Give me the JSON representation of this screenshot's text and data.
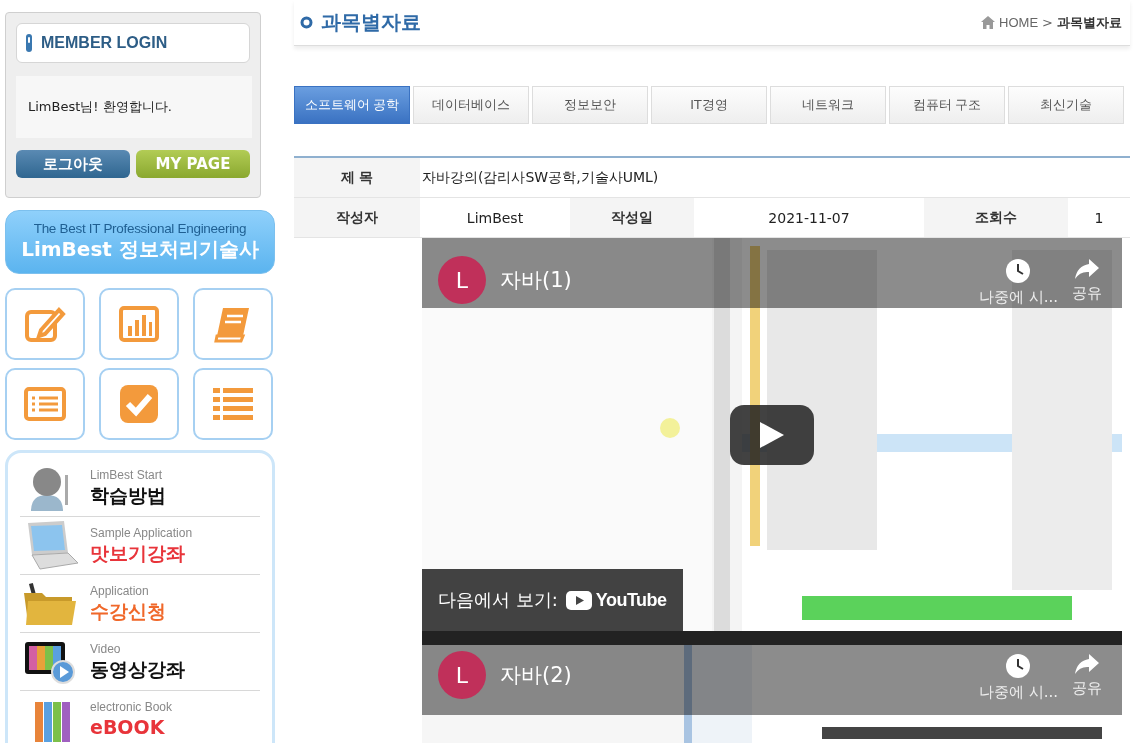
{
  "sidebar": {
    "login": {
      "title": "MEMBER LOGIN",
      "welcome": "LimBest님! 환영합니다.",
      "buttons": [
        {
          "label": "로그아웃",
          "kind": "logout"
        },
        {
          "label": "MY PAGE",
          "kind": "mypage"
        }
      ]
    },
    "banner": {
      "subtitle": "The Best IT Professional Engineering",
      "title": "LimBest 정보처리기술사"
    },
    "menu": [
      {
        "caption": "LimBest Start",
        "label": "학습방법",
        "color": "#111111"
      },
      {
        "caption": "Sample Application",
        "label": "맛보기강좌",
        "color": "#e8343a"
      },
      {
        "caption": "Application",
        "label": "수강신청",
        "color": "#f0682a"
      },
      {
        "caption": "Video",
        "label": "동영상강좌",
        "color": "#111111"
      },
      {
        "caption": "electronic Book",
        "label": "eBOOK",
        "color": "#e8343a"
      }
    ]
  },
  "page": {
    "title": "과목별자료",
    "breadcrumb": {
      "home": "HOME",
      "separator": ">",
      "current": "과목별자료"
    }
  },
  "tabs": [
    {
      "label": "소프트웨어 공학",
      "selected": true
    },
    {
      "label": "데이터베이스",
      "selected": false
    },
    {
      "label": "정보보안",
      "selected": false
    },
    {
      "label": "IT경영",
      "selected": false
    },
    {
      "label": "네트워크",
      "selected": false
    },
    {
      "label": "컴퓨터 구조",
      "selected": false
    },
    {
      "label": "최신기술",
      "selected": false
    }
  ],
  "post": {
    "title_label": "제 목",
    "title": "자바강의(감리사SW공학,기술사UML)",
    "fields": [
      {
        "label": "작성자",
        "value": "LimBest"
      },
      {
        "label": "작성일",
        "value": "2021-11-07"
      },
      {
        "label": "조회수",
        "value": "1"
      }
    ]
  },
  "videos": [
    {
      "kind": "explorer",
      "channel_initial": "L",
      "title": "자바(1)",
      "watch_later": "나중에 시...",
      "share": "공유",
      "play_button": true,
      "watch_on": "다음에서 보기:",
      "watch_on_brand": "YouTube"
    },
    {
      "kind": "editor",
      "channel_initial": "L",
      "title": "자바(2)",
      "watch_later": "나중에 시...",
      "share": "공유"
    }
  ]
}
